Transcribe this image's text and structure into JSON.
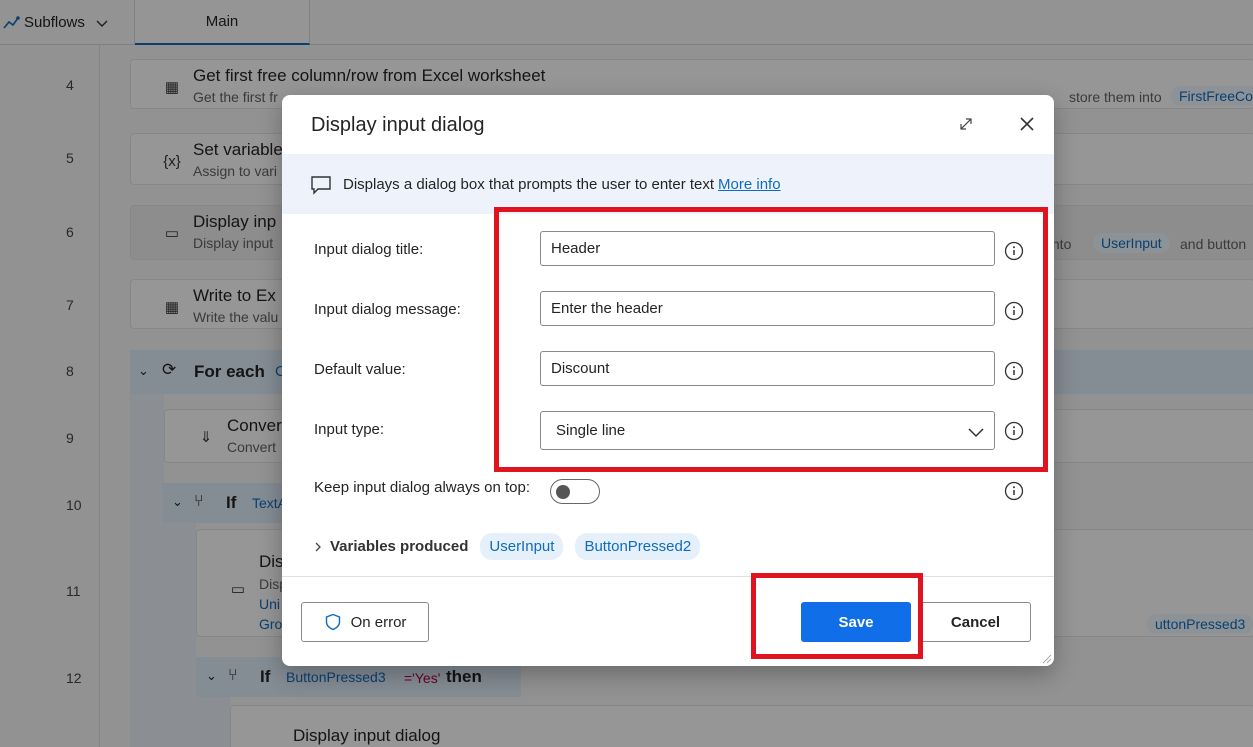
{
  "header": {
    "subflows_label": "Subflows",
    "main_tab": "Main"
  },
  "line_numbers": [
    "4",
    "5",
    "6",
    "7",
    "8",
    "9",
    "10",
    "11",
    "12"
  ],
  "background": {
    "step4": {
      "title": "Get first free column/row from Excel worksheet",
      "desc": "Get the first fr",
      "desc_tail": "store them into",
      "var": "FirstFreeColumn"
    },
    "step5": {
      "title": "Set variable",
      "desc": "Assign to vari"
    },
    "step6": {
      "title": "Display inp",
      "desc": "Display input",
      "tail": "t into",
      "var": "UserInput",
      "tail2": "and button"
    },
    "step7": {
      "title": "Write to Ex",
      "desc": "Write the valu"
    },
    "step8": {
      "keyword": "For each",
      "var_initial": "C"
    },
    "step9": {
      "title": "Conver",
      "desc": "Convert"
    },
    "step10": {
      "keyword": "If",
      "cond": "TextA"
    },
    "step11": {
      "title": "Dis",
      "desc1": "Disp",
      "desc2": "Uni",
      "desc3": "Gro",
      "var": "uttonPressed3"
    },
    "step12": {
      "keyword": "If",
      "var": "ButtonPressed3",
      "op": "='Yes'",
      "then": "then"
    },
    "step13": {
      "title": "Display input dialog"
    }
  },
  "dialog": {
    "title": "Display input dialog",
    "info_text": "Displays a dialog box that prompts the user to enter text",
    "more_info": "More info",
    "fields": {
      "title_label": "Input dialog title:",
      "title_value": "Header",
      "message_label": "Input dialog message:",
      "message_value": "Enter the header",
      "default_label": "Default value:",
      "default_value": "Discount",
      "type_label": "Input type:",
      "type_value": "Single line",
      "ontop_label": "Keep input dialog always on top:"
    },
    "variables_label": "Variables produced",
    "variables": [
      "UserInput",
      "ButtonPressed2"
    ],
    "buttons": {
      "on_error": "On error",
      "save": "Save",
      "cancel": "Cancel"
    }
  },
  "colors": {
    "accent": "#0f6cbd",
    "save_button": "#0f6ee8",
    "highlight": "#e0141e"
  }
}
